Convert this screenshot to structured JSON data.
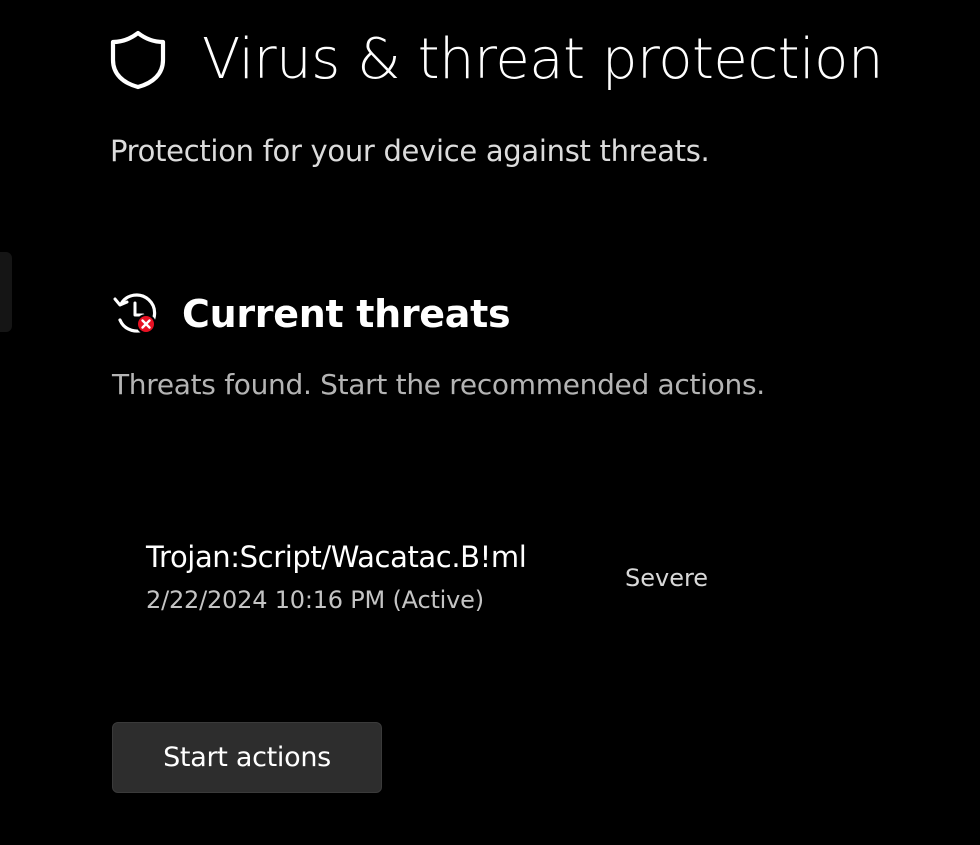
{
  "header": {
    "icon": "shield-icon",
    "title": "Virus & threat protection",
    "subtitle": "Protection for your device against threats."
  },
  "current_threats": {
    "icon": "threat-history-icon",
    "title": "Current threats",
    "subtitle": "Threats found. Start the recommended actions.",
    "items": [
      {
        "name": "Trojan:Script/Wacatac.B!ml",
        "date": "2/22/2024 10:16 PM (Active)",
        "severity": "Severe"
      }
    ],
    "action_label": "Start actions"
  },
  "colors": {
    "background": "#000000",
    "text": "#ffffff",
    "secondary_text": "#b4b4b4",
    "button_background": "#2d2d2d",
    "alert_red": "#e81123"
  }
}
